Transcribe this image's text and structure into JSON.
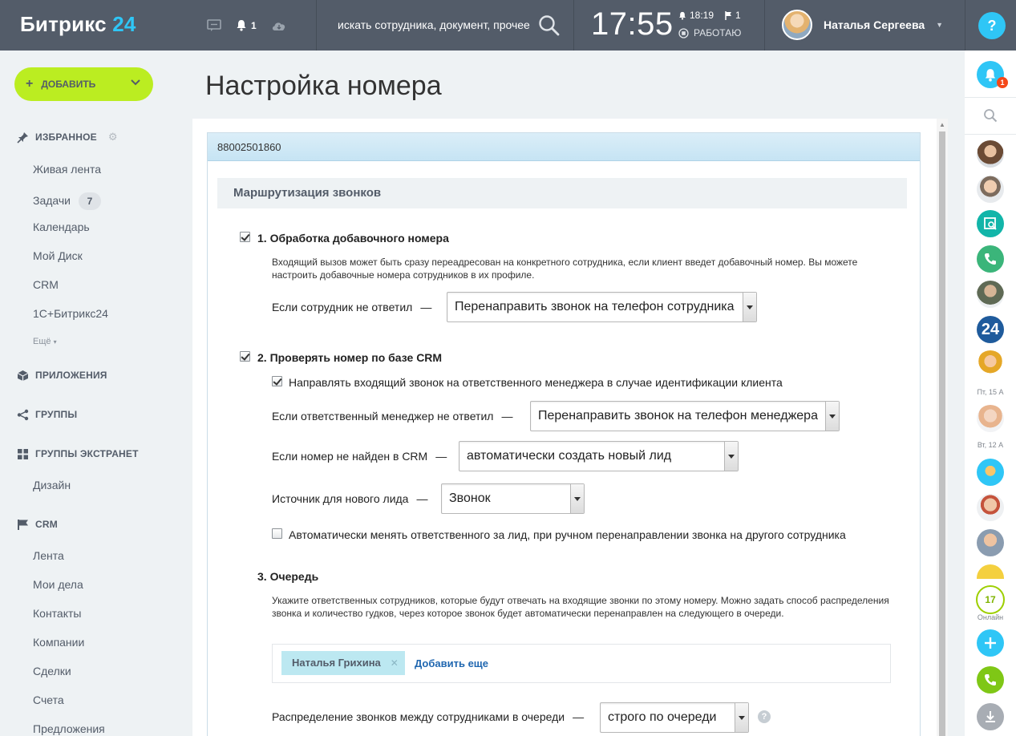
{
  "header": {
    "logo_main": "Битрикс",
    "logo_accent": "24",
    "notifications_count": "1",
    "search_placeholder": "искать сотрудника, документ, прочее...",
    "clock": "17:55",
    "alarm_time": "18:19",
    "flag_count": "1",
    "work_status": "РАБОТАЮ",
    "user_name": "Наталья Сергеева",
    "help": "?"
  },
  "left_menu": {
    "add_button": "ДОБАВИТЬ",
    "favorites": "ИЗБРАННОЕ",
    "items": [
      "Живая лента",
      "Задачи",
      "Календарь",
      "Мой Диск",
      "CRM",
      "1С+Битрикс24"
    ],
    "tasks_counter": "7",
    "more": "Ещё",
    "apps": "ПРИЛОЖЕНИЯ",
    "groups": "ГРУППЫ",
    "extranet": "ГРУППЫ ЭКСТРАНЕТ",
    "extranet_items": [
      "Дизайн"
    ],
    "crm": "CRM",
    "crm_items": [
      "Лента",
      "Мои дела",
      "Контакты",
      "Компании",
      "Сделки",
      "Счета",
      "Предложения"
    ]
  },
  "right_panel": {
    "notif_badge": "1",
    "date1": "Пт, 15 А",
    "date2": "Вт, 12 А",
    "bitrix_badge": "24",
    "online_count": "17",
    "online_label": "Онлайн"
  },
  "page": {
    "title": "Настройка номера",
    "phone_number": "88002501860",
    "section_title": "Маршрутизация звонков",
    "s1": {
      "title": "1. Обработка добавочного номера",
      "checked": true,
      "desc": "Входящий вызов может быть сразу переадресован на конкретного сотрудника, если клиент введет добавочный номер. Вы можете настроить добавочные номера сотрудников в их профиле.",
      "label": "Если сотрудник не ответил",
      "select": "Перенаправить звонок на телефон сотрудника"
    },
    "s2": {
      "title": "2. Проверять номер по базе CRM",
      "checked": true,
      "sub_check": "Направлять входящий звонок на ответственного менеджера в случае идентификации клиента",
      "sub_checked": true,
      "label1": "Если ответственный менеджер не ответил",
      "select1": "Перенаправить звонок на телефон менеджера",
      "label2": "Если номер не найден в CRM",
      "select2": "автоматически создать новый лид",
      "label3": "Источник для нового лида",
      "select3": "Звонок",
      "auto_check": "Автоматически менять ответственного за лид, при ручном перенаправлении звонка на другого сотрудника",
      "auto_checked": false
    },
    "s3": {
      "title": "3. Очередь",
      "desc": "Укажите ответственных сотрудников, которые будут отвечать на входящие звонки по этому номеру. Можно задать способ распределения звонка и количество гудков, через которое звонок будет автоматически перенаправлен на следующего в очереди.",
      "tag": "Наталья Грихина",
      "add_more": "Добавить еще",
      "label": "Распределение звонков между сотрудниками в очереди",
      "select": "строго по очереди",
      "help": "?"
    },
    "dash": "—"
  },
  "colors": {
    "header_bg": "#535c69",
    "accent_blue": "#2fc6f6",
    "add_green": "#bbed21",
    "link_blue": "#2067b0"
  }
}
